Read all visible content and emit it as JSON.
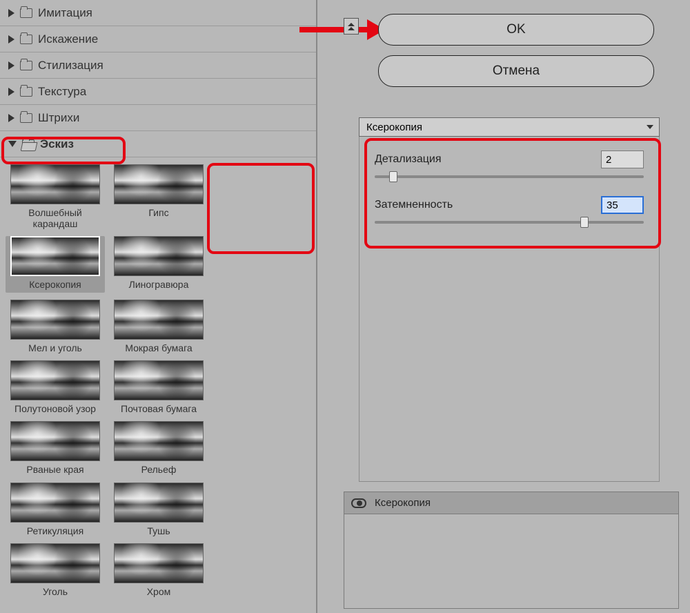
{
  "categories": [
    {
      "label": "Имитация",
      "expanded": false
    },
    {
      "label": "Искажение",
      "expanded": false
    },
    {
      "label": "Стилизация",
      "expanded": false
    },
    {
      "label": "Текстура",
      "expanded": false
    },
    {
      "label": "Штрихи",
      "expanded": false
    },
    {
      "label": "Эскиз",
      "expanded": true
    }
  ],
  "thumbnails": [
    {
      "label": "Волшебный карандаш"
    },
    {
      "label": "Гипс"
    },
    {
      "label": "Ксерокопия",
      "selected": true
    },
    {
      "label": "Линогравюра"
    },
    {
      "label": "Мел и уголь"
    },
    {
      "label": "Мокрая бумага"
    },
    {
      "label": "Полутоновой узор"
    },
    {
      "label": "Почтовая бумага"
    },
    {
      "label": "Рваные края"
    },
    {
      "label": "Рельеф"
    },
    {
      "label": "Ретикуляция"
    },
    {
      "label": "Тушь"
    },
    {
      "label": "Уголь"
    },
    {
      "label": "Хром"
    }
  ],
  "buttons": {
    "ok": "OK",
    "cancel": "Отмена"
  },
  "filter_select": {
    "value": "Ксерокопия"
  },
  "params": [
    {
      "label": "Детализация",
      "value": "2",
      "slider_percent": 7,
      "focused": false
    },
    {
      "label": "Затемненность",
      "value": "35",
      "slider_percent": 78,
      "focused": true
    }
  ],
  "layers": {
    "active": "Ксерокопия"
  }
}
